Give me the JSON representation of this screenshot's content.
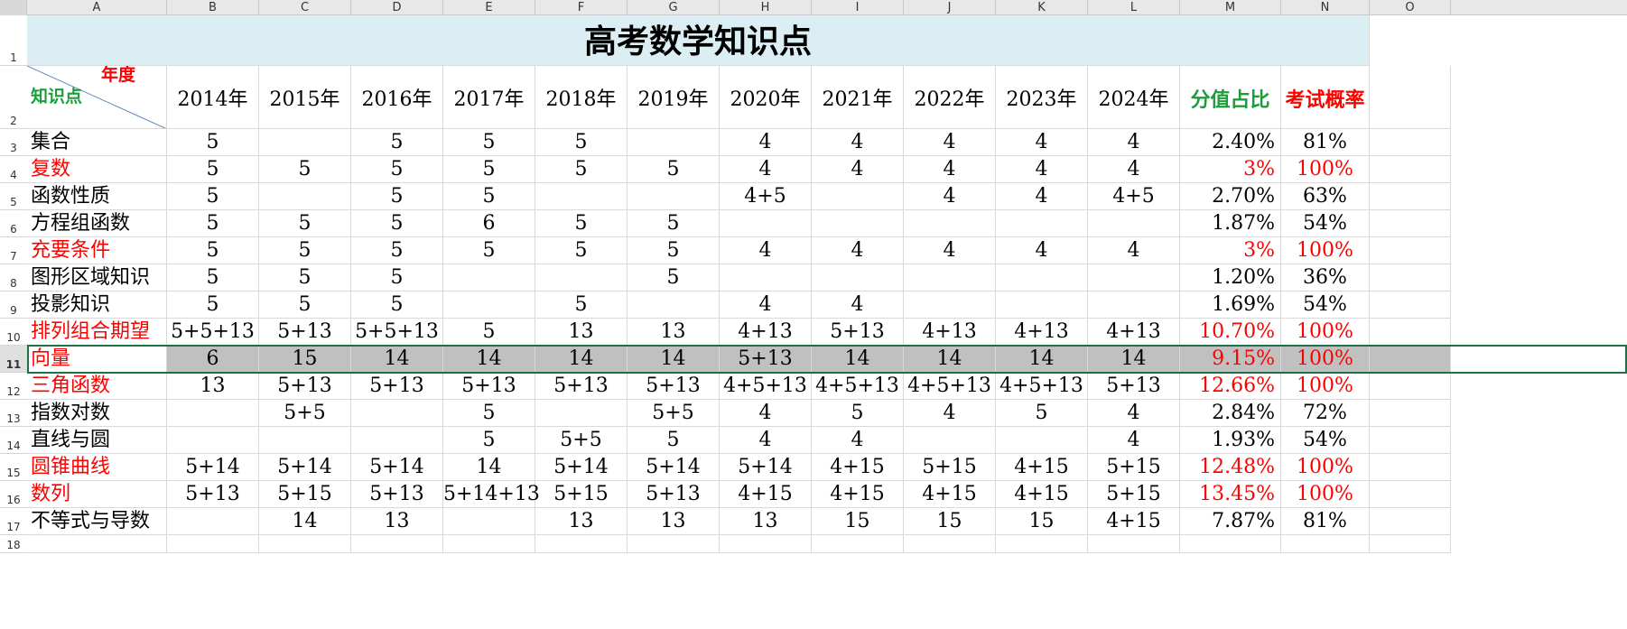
{
  "columns": [
    "A",
    "B",
    "C",
    "D",
    "E",
    "F",
    "G",
    "H",
    "I",
    "J",
    "K",
    "L",
    "M",
    "N",
    "O"
  ],
  "row_numbers": [
    "1",
    "2",
    "3",
    "4",
    "5",
    "6",
    "7",
    "8",
    "9",
    "10",
    "11",
    "12",
    "13",
    "14",
    "15",
    "16",
    "17",
    "18"
  ],
  "title": "高考数学知识点",
  "header": {
    "diag_top": "年度",
    "diag_bottom": "知识点",
    "years": [
      "2014年",
      "2015年",
      "2016年",
      "2017年",
      "2018年",
      "2019年",
      "2020年",
      "2021年",
      "2022年",
      "2023年",
      "2024年"
    ],
    "share": "分值占比",
    "prob": "考试概率"
  },
  "rows": [
    {
      "name": "集合",
      "red": false,
      "cells": [
        "5",
        "",
        "5",
        "5",
        "5",
        "",
        "4",
        "4",
        "4",
        "4",
        "4"
      ],
      "share": "2.40%",
      "prob": "81%"
    },
    {
      "name": "复数",
      "red": true,
      "cells": [
        "5",
        "5",
        "5",
        "5",
        "5",
        "5",
        "4",
        "4",
        "4",
        "4",
        "4"
      ],
      "share": "3%",
      "prob": "100%"
    },
    {
      "name": "函数性质",
      "red": false,
      "cells": [
        "5",
        "",
        "5",
        "5",
        "",
        "",
        "4+5",
        "",
        "4",
        "4",
        "4+5"
      ],
      "share": "2.70%",
      "prob": "63%"
    },
    {
      "name": "方程组函数",
      "red": false,
      "cells": [
        "5",
        "5",
        "5",
        "6",
        "5",
        "5",
        "",
        "",
        "",
        "",
        ""
      ],
      "share": "1.87%",
      "prob": "54%"
    },
    {
      "name": "充要条件",
      "red": true,
      "cells": [
        "5",
        "5",
        "5",
        "5",
        "5",
        "5",
        "4",
        "4",
        "4",
        "4",
        "4"
      ],
      "share": "3%",
      "prob": "100%"
    },
    {
      "name": "图形区域知识",
      "red": false,
      "cells": [
        "5",
        "5",
        "5",
        "",
        "",
        "5",
        "",
        "",
        "",
        "",
        ""
      ],
      "share": "1.20%",
      "prob": "36%"
    },
    {
      "name": "投影知识",
      "red": false,
      "cells": [
        "5",
        "5",
        "5",
        "",
        "5",
        "",
        "4",
        "4",
        "",
        "",
        ""
      ],
      "share": "1.69%",
      "prob": "54%"
    },
    {
      "name": "排列组合期望",
      "red": true,
      "cells": [
        "5+5+13",
        "5+13",
        "5+5+13",
        "5",
        "13",
        "13",
        "4+13",
        "5+13",
        "4+13",
        "4+13",
        "4+13"
      ],
      "share": "10.70%",
      "prob": "100%"
    },
    {
      "name": "向量",
      "red": true,
      "selected": true,
      "cells": [
        "6",
        "15",
        "14",
        "14",
        "14",
        "14",
        "5+13",
        "14",
        "14",
        "14",
        "14"
      ],
      "share": "9.15%",
      "prob": "100%"
    },
    {
      "name": "三角函数",
      "red": true,
      "cells": [
        "13",
        "5+13",
        "5+13",
        "5+13",
        "5+13",
        "5+13",
        "4+5+13",
        "4+5+13",
        "4+5+13",
        "4+5+13",
        "5+13"
      ],
      "share": "12.66%",
      "prob": "100%"
    },
    {
      "name": "指数对数",
      "red": false,
      "cells": [
        "",
        "5+5",
        "",
        "5",
        "",
        "5+5",
        "4",
        "5",
        "4",
        "5",
        "4"
      ],
      "share": "2.84%",
      "prob": "72%"
    },
    {
      "name": "直线与圆",
      "red": false,
      "cells": [
        "",
        "",
        "",
        "5",
        "5+5",
        "5",
        "4",
        "4",
        "",
        "",
        "4"
      ],
      "share": "1.93%",
      "prob": "54%"
    },
    {
      "name": "圆锥曲线",
      "red": true,
      "cells": [
        "5+14",
        "5+14",
        "5+14",
        "14",
        "5+14",
        "5+14",
        "5+14",
        "4+15",
        "5+15",
        "4+15",
        "5+15"
      ],
      "share": "12.48%",
      "prob": "100%"
    },
    {
      "name": "数列",
      "red": true,
      "cells": [
        "5+13",
        "5+15",
        "5+13",
        "5+14+13",
        "5+15",
        "5+13",
        "4+15",
        "4+15",
        "4+15",
        "4+15",
        "5+15"
      ],
      "share": "13.45%",
      "prob": "100%"
    },
    {
      "name": "不等式与导数",
      "red": false,
      "cells": [
        "",
        "14",
        "13",
        "",
        "13",
        "13",
        "13",
        "15",
        "15",
        "15",
        "4+15"
      ],
      "share": "7.87%",
      "prob": "81%"
    }
  ]
}
